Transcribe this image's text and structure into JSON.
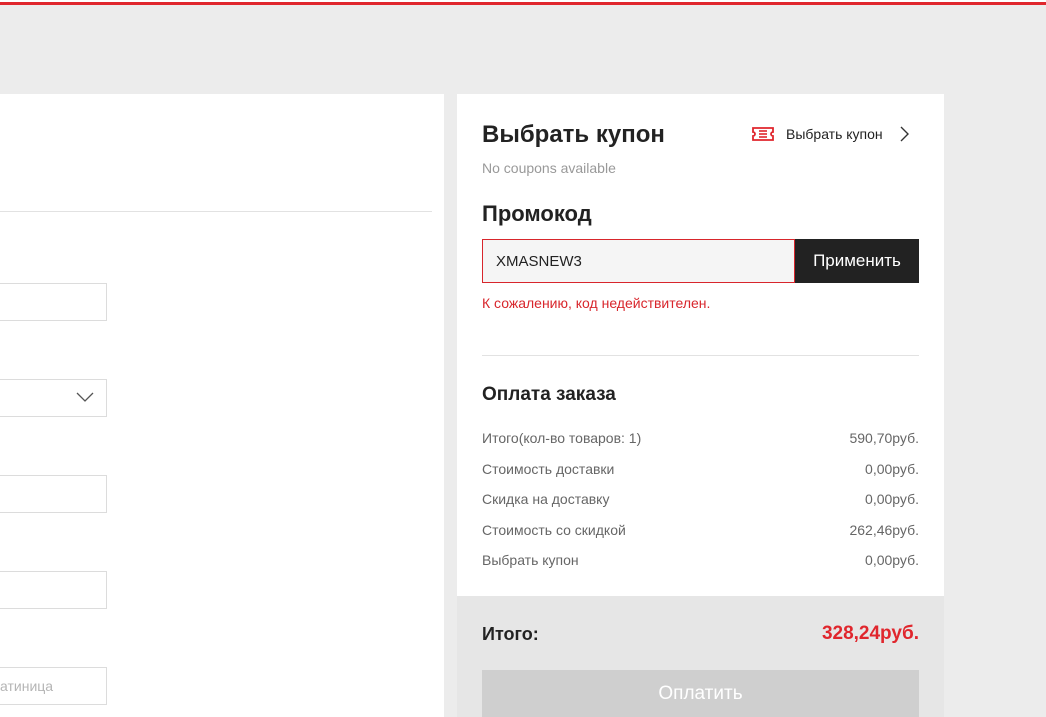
{
  "coupon": {
    "title": "Выбрать купон",
    "link_label": "Выбрать купон",
    "status": "No coupons available",
    "icon": "ticket-icon"
  },
  "promo": {
    "title": "Промокод",
    "value": "XMASNEW3",
    "apply_label": "Применить",
    "error": "К сожалению, код недействителен."
  },
  "payment": {
    "title": "Оплата заказа",
    "rows": [
      {
        "label": "Итого(кол-во товаров: 1)",
        "value": "590,70руб."
      },
      {
        "label": "Стоимость доставки",
        "value": "0,00руб."
      },
      {
        "label": "Скидка на доставку",
        "value": "0,00руб."
      },
      {
        "label": "Стоимость со скидкой",
        "value": "262,46руб."
      },
      {
        "label": "Выбрать купон",
        "value": "0,00руб."
      }
    ],
    "total_label": "Итого:",
    "total_value": "328,24руб.",
    "pay_label": "Оплатить"
  },
  "left_form": {
    "partial_placeholder": "атиница"
  },
  "colors": {
    "accent": "#e0262d",
    "dark_button": "#222222",
    "disabled_button": "#cfcfcf"
  }
}
